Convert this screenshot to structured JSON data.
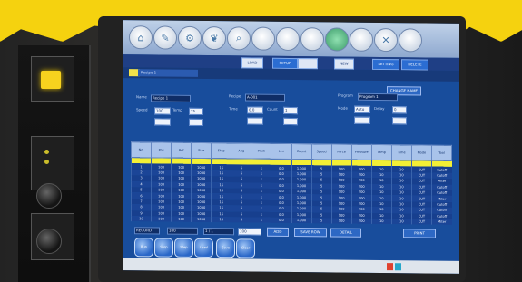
{
  "photo": {
    "yellow_color": "#f5d20f",
    "screen_color": "#184d9c"
  },
  "top_icons": [
    "home-icon",
    "tool-icon",
    "gear-icon",
    "leaf-icon",
    "search-icon",
    "blank-icon",
    "blank-icon",
    "blank-icon",
    "circle-icon",
    "blank-icon",
    "wrench-icon",
    "blank-icon"
  ],
  "nav": {
    "title": "Recipe 1",
    "buttons": [
      "LOAD",
      "SETUP",
      "",
      "NEW",
      "SETTING",
      "DELETE"
    ]
  },
  "form": {
    "action_button": "CHANGE NAME",
    "labels": [
      "Name",
      "Recipe",
      "Program",
      "Speed",
      "Temp",
      "Time",
      "Count",
      "Mode",
      "Delay"
    ],
    "values": [
      "Recipe 1",
      "A-001",
      "Program 1",
      "100",
      "25",
      "0.0",
      "1",
      "Auto",
      "0"
    ]
  },
  "table": {
    "headers": [
      "No.",
      "Pos",
      "Ref",
      "Size",
      "Step",
      "Ang",
      "Pitch",
      "Len",
      "Count",
      "Speed",
      "Force",
      "Pressure",
      "Temp",
      "Time",
      "Mode",
      "Tool"
    ],
    "rows": [
      [
        "1",
        "100",
        "100",
        "1000",
        "15",
        "5",
        "1",
        "0.0",
        "1.000",
        "5",
        "100",
        "200",
        "10",
        "10",
        "CUT",
        "Cutoff"
      ],
      [
        "2",
        "100",
        "100",
        "1000",
        "15",
        "5",
        "1",
        "0.0",
        "1.000",
        "5",
        "100",
        "200",
        "10",
        "10",
        "CUT",
        "Cutoff"
      ],
      [
        "3",
        "100",
        "100",
        "1000",
        "15",
        "5",
        "1",
        "0.0",
        "1.000",
        "5",
        "100",
        "200",
        "10",
        "10",
        "CUT",
        "Miter"
      ],
      [
        "4",
        "100",
        "100",
        "1000",
        "15",
        "5",
        "1",
        "0.0",
        "1.000",
        "5",
        "100",
        "200",
        "10",
        "10",
        "CUT",
        "Cutoff"
      ],
      [
        "5",
        "100",
        "100",
        "1000",
        "15",
        "5",
        "1",
        "0.0",
        "1.000",
        "5",
        "100",
        "200",
        "10",
        "10",
        "CUT",
        "Cutoff"
      ],
      [
        "6",
        "100",
        "100",
        "1000",
        "15",
        "5",
        "1",
        "0.0",
        "1.000",
        "5",
        "100",
        "200",
        "10",
        "10",
        "CUT",
        "Miter"
      ],
      [
        "7",
        "100",
        "100",
        "1000",
        "15",
        "5",
        "1",
        "0.0",
        "1.000",
        "5",
        "100",
        "200",
        "10",
        "10",
        "CUT",
        "Cutoff"
      ],
      [
        "8",
        "100",
        "100",
        "1000",
        "15",
        "5",
        "1",
        "0.0",
        "1.000",
        "5",
        "100",
        "200",
        "10",
        "10",
        "CUT",
        "Cutoff"
      ],
      [
        "9",
        "100",
        "100",
        "1000",
        "15",
        "5",
        "1",
        "0.0",
        "1.000",
        "5",
        "100",
        "200",
        "10",
        "10",
        "CUT",
        "Cutoff"
      ],
      [
        "10",
        "100",
        "100",
        "1000",
        "15",
        "5",
        "1",
        "0.0",
        "1.000",
        "5",
        "100",
        "200",
        "10",
        "10",
        "CUT",
        "Miter"
      ]
    ]
  },
  "bottom": {
    "fields": [
      "RECORD",
      "100",
      "1 / 1",
      "100"
    ],
    "buttons": [
      "ADD",
      "SAVE ROW",
      "DETAIL",
      "PRINT"
    ],
    "round_buttons": [
      "Run",
      "Stop",
      "Step",
      "Load",
      "Save",
      "Clear"
    ]
  }
}
